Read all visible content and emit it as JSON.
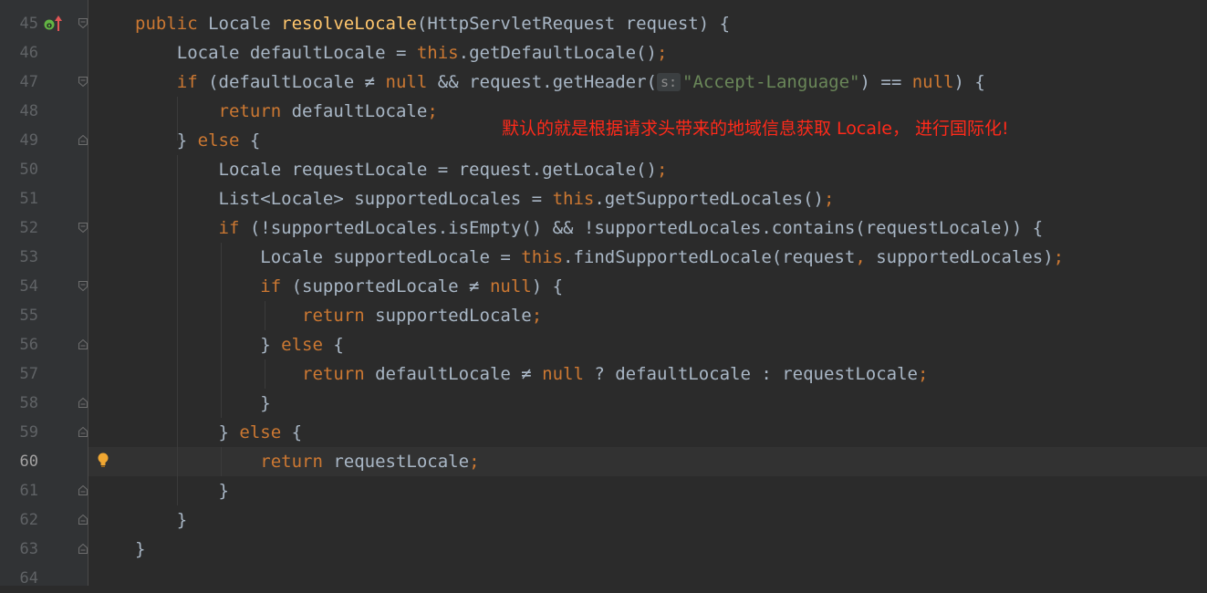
{
  "editor": {
    "annotation": "默认的就是根据请求头带来的地域信息获取 Locale， 进行国际化!",
    "current_line": "60",
    "lines": [
      {
        "n": "45",
        "tokens": [
          [
            "kw",
            "public "
          ],
          [
            "pl",
            "Locale "
          ],
          [
            "fn",
            "resolveLocale"
          ],
          [
            "pl",
            "(HttpServletRequest request) {"
          ]
        ]
      },
      {
        "n": "46",
        "tokens": [
          [
            "pl",
            "    Locale defaultLocale = "
          ],
          [
            "kw",
            "this"
          ],
          [
            "pl",
            ".getDefaultLocale()"
          ],
          [
            "sep",
            ";"
          ]
        ]
      },
      {
        "n": "47",
        "tokens": [
          [
            "kw",
            "    if "
          ],
          [
            "pl",
            "(defaultLocale ≠ "
          ],
          [
            "kw",
            "null "
          ],
          [
            "pl",
            "&& request.getHeader("
          ],
          [
            "hint",
            "s:"
          ],
          [
            "str",
            "\"Accept-Language\""
          ],
          [
            "pl",
            ") == "
          ],
          [
            "kw",
            "null"
          ],
          [
            "pl",
            ") {"
          ]
        ]
      },
      {
        "n": "48",
        "tokens": [
          [
            "kw",
            "        return "
          ],
          [
            "pl",
            "defaultLocale"
          ],
          [
            "sep",
            ";"
          ]
        ]
      },
      {
        "n": "49",
        "tokens": [
          [
            "pl",
            "    } "
          ],
          [
            "kw",
            "else "
          ],
          [
            "pl",
            "{"
          ]
        ]
      },
      {
        "n": "50",
        "tokens": [
          [
            "pl",
            "        Locale requestLocale = request.getLocale()"
          ],
          [
            "sep",
            ";"
          ]
        ]
      },
      {
        "n": "51",
        "tokens": [
          [
            "pl",
            "        List<Locale> supportedLocales = "
          ],
          [
            "kw",
            "this"
          ],
          [
            "pl",
            ".getSupportedLocales()"
          ],
          [
            "sep",
            ";"
          ]
        ]
      },
      {
        "n": "52",
        "tokens": [
          [
            "kw",
            "        if "
          ],
          [
            "pl",
            "(!supportedLocales.isEmpty() && !supportedLocales.contains(requestLocale)) {"
          ]
        ]
      },
      {
        "n": "53",
        "tokens": [
          [
            "pl",
            "            Locale supportedLocale = "
          ],
          [
            "kw",
            "this"
          ],
          [
            "pl",
            ".findSupportedLocale(request"
          ],
          [
            "sep",
            ", "
          ],
          [
            "pl",
            "supportedLocales)"
          ],
          [
            "sep",
            ";"
          ]
        ]
      },
      {
        "n": "54",
        "tokens": [
          [
            "kw",
            "            if "
          ],
          [
            "pl",
            "(supportedLocale ≠ "
          ],
          [
            "kw",
            "null"
          ],
          [
            "pl",
            ") {"
          ]
        ]
      },
      {
        "n": "55",
        "tokens": [
          [
            "kw",
            "                return "
          ],
          [
            "pl",
            "supportedLocale"
          ],
          [
            "sep",
            ";"
          ]
        ]
      },
      {
        "n": "56",
        "tokens": [
          [
            "pl",
            "            } "
          ],
          [
            "kw",
            "else "
          ],
          [
            "pl",
            "{"
          ]
        ]
      },
      {
        "n": "57",
        "tokens": [
          [
            "kw",
            "                return "
          ],
          [
            "pl",
            "defaultLocale ≠ "
          ],
          [
            "kw",
            "null "
          ],
          [
            "pl",
            "? defaultLocale : requestLocale"
          ],
          [
            "sep",
            ";"
          ]
        ]
      },
      {
        "n": "58",
        "tokens": [
          [
            "pl",
            "            }"
          ]
        ]
      },
      {
        "n": "59",
        "tokens": [
          [
            "pl",
            "        } "
          ],
          [
            "kw",
            "else "
          ],
          [
            "pl",
            "{"
          ]
        ]
      },
      {
        "n": "60",
        "tokens": [
          [
            "kw",
            "            return "
          ],
          [
            "pl",
            "requestLocale"
          ],
          [
            "sep",
            ";"
          ]
        ]
      },
      {
        "n": "61",
        "tokens": [
          [
            "pl",
            "        }"
          ]
        ]
      },
      {
        "n": "62",
        "tokens": [
          [
            "pl",
            "    }"
          ]
        ]
      },
      {
        "n": "63",
        "tokens": [
          [
            "pl",
            "}"
          ]
        ]
      },
      {
        "n": "64",
        "tokens": []
      }
    ],
    "folds": {
      "45": "open",
      "47": "open",
      "49": "close",
      "52": "open",
      "54": "open",
      "56": "close",
      "58": "close",
      "59": "close",
      "61": "close",
      "62": "close",
      "63": "close"
    },
    "colors": {
      "background": "#2b2b2b",
      "keyword": "#cc7832",
      "method": "#ffc66d",
      "string": "#6a8759",
      "plain": "#a9b7c6",
      "annotation": "#ff2a1a"
    },
    "icons": {
      "line45": "override-method-icon",
      "line60": "intention-bulb-icon"
    }
  }
}
